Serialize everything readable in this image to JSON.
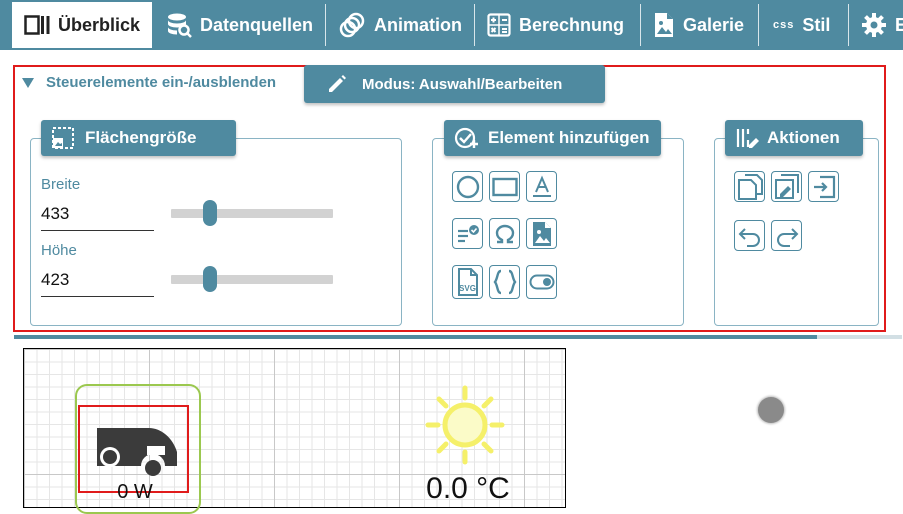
{
  "tabs": [
    {
      "label": "Überblick",
      "icon": "overview-icon"
    },
    {
      "label": "Datenquellen",
      "icon": "datasource-icon"
    },
    {
      "label": "Animation",
      "icon": "animation-icon"
    },
    {
      "label": "Berechnung",
      "icon": "calculator-icon"
    },
    {
      "label": "Galerie",
      "icon": "gallery-icon"
    },
    {
      "label": "Stil",
      "icon": "css-icon"
    },
    {
      "label": "E",
      "icon": "gear-icon"
    }
  ],
  "toggle": {
    "label": "Steuerelemente ein-/ausblenden"
  },
  "mode": {
    "label": "Modus: Auswahl/Bearbeiten",
    "icon": "pencil-icon"
  },
  "size_panel": {
    "title": "Flächengröße",
    "width_label": "Breite",
    "width_value": "433",
    "width_fraction": 0.24,
    "height_label": "Höhe",
    "height_value": "423",
    "height_fraction": 0.24
  },
  "add_panel": {
    "title": "Element hinzufügen",
    "buttons": [
      "circle-icon",
      "rectangle-icon",
      "text-icon",
      "list-check-icon",
      "omega-icon",
      "image-icon",
      "svg-file-icon",
      "braces-icon",
      "toggle-switch-icon"
    ],
    "svg_badge": "SVG"
  },
  "actions_panel": {
    "title": "Aktionen",
    "buttons": [
      "copy-icon",
      "edit-copy-icon",
      "import-icon",
      "undo-icon",
      "redo-icon"
    ]
  },
  "canvas": {
    "power_value": "0 W",
    "temperature_value": "0.0 °C",
    "colors": {
      "frame": "#9bc84f",
      "sun": "#f5f06a"
    }
  },
  "theme": {
    "accent": "#4f8aa0",
    "highlight": "#e01b1b"
  }
}
